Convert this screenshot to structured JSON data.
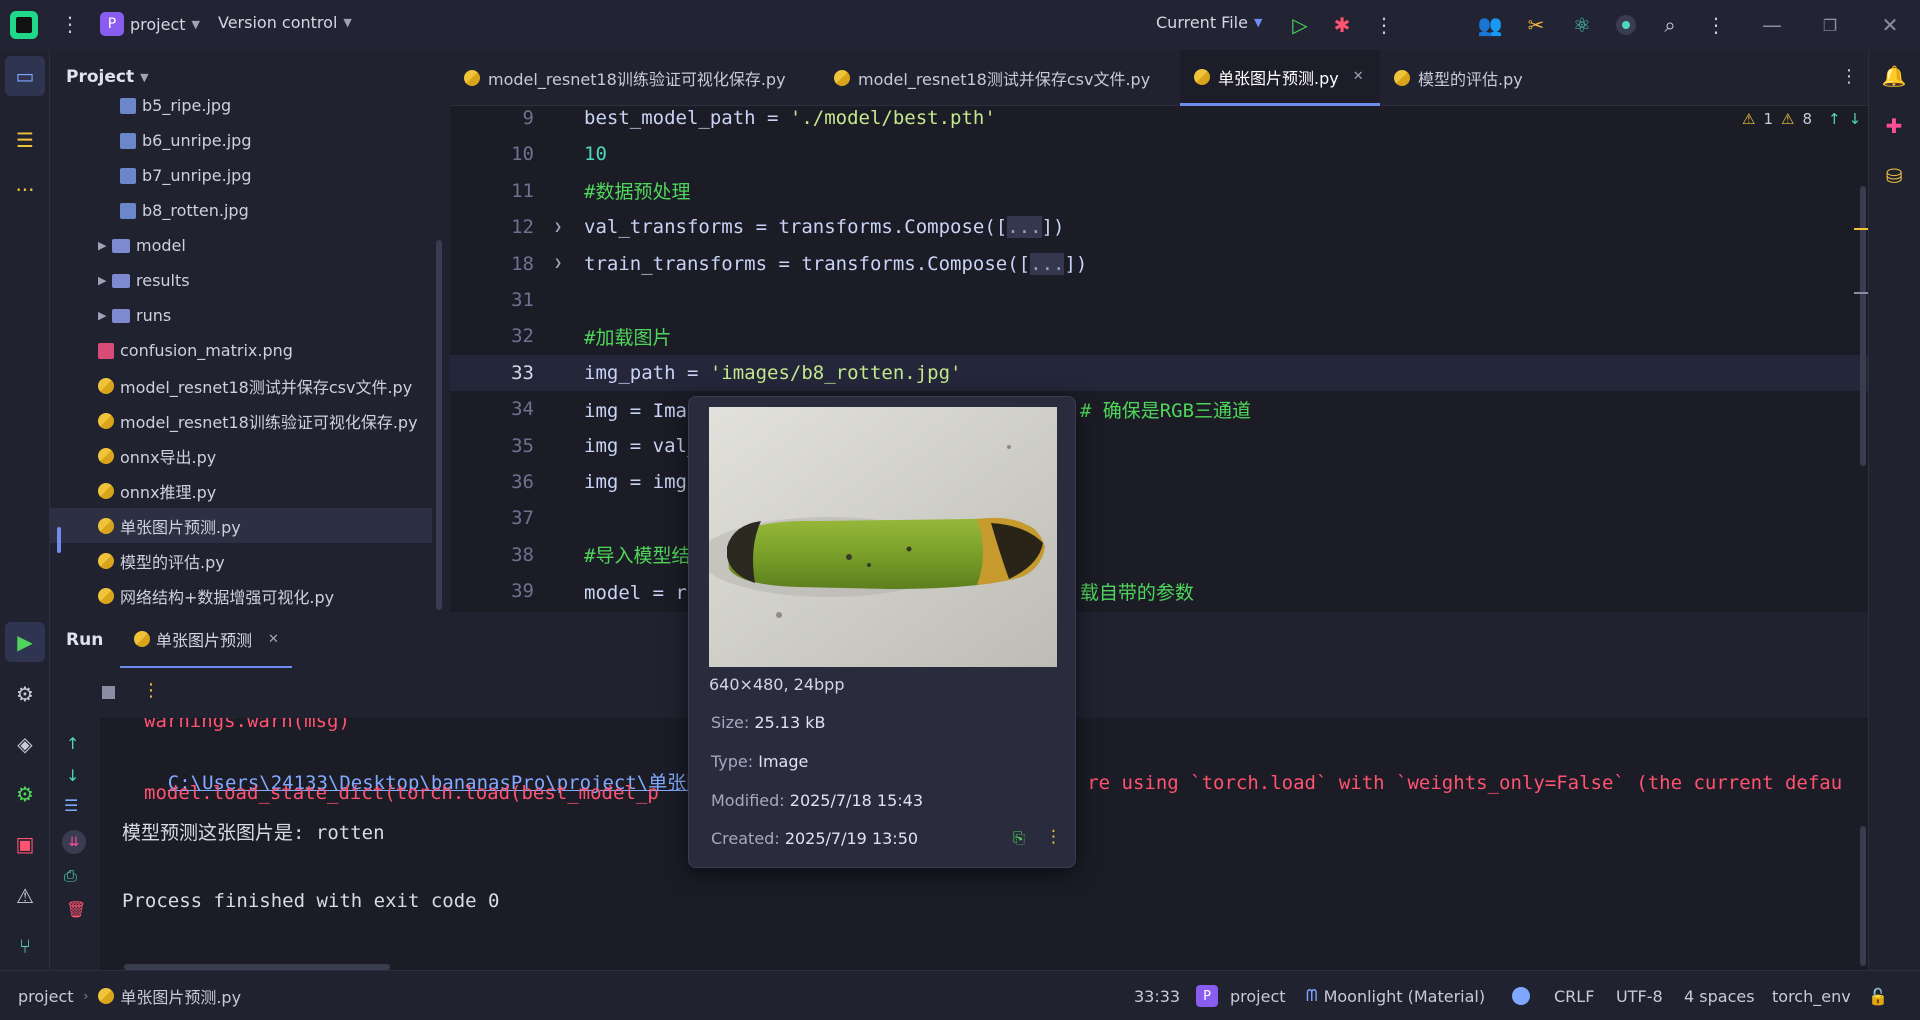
{
  "topbar": {
    "project_initial": "P",
    "project_name": "project",
    "version_control": "Version control",
    "run_config": "Current File",
    "colors": {
      "bg": "#222333",
      "project_badge": "#8a5cf0"
    }
  },
  "project_panel": {
    "title": "Project",
    "items": [
      {
        "label": "b5_ripe.jpg",
        "kind": "image"
      },
      {
        "label": "b6_unripe.jpg",
        "kind": "image"
      },
      {
        "label": "b7_unripe.jpg",
        "kind": "image"
      },
      {
        "label": "b8_rotten.jpg",
        "kind": "image"
      },
      {
        "label": "model",
        "kind": "folder"
      },
      {
        "label": "results",
        "kind": "folder"
      },
      {
        "label": "runs",
        "kind": "folder"
      },
      {
        "label": "confusion_matrix.png",
        "kind": "png"
      },
      {
        "label": "model_resnet18测试并保存csv文件.py",
        "kind": "python"
      },
      {
        "label": "model_resnet18训练验证可视化保存.py",
        "kind": "python"
      },
      {
        "label": "onnx导出.py",
        "kind": "python"
      },
      {
        "label": "onnx推理.py",
        "kind": "python"
      },
      {
        "label": "单张图片预测.py",
        "kind": "python",
        "selected": true
      },
      {
        "label": "模型的评估.py",
        "kind": "python"
      },
      {
        "label": "网络结构+数据增强可视化.py",
        "kind": "python"
      }
    ]
  },
  "tabs": [
    {
      "label": "model_resnet18训练验证可视化保存.py"
    },
    {
      "label": "model_resnet18测试并保存csv文件.py"
    },
    {
      "label": "单张图片预测.py",
      "active": true
    },
    {
      "label": "模型的评估.py"
    }
  ],
  "inspections": {
    "warn1": "1",
    "warn2": "8"
  },
  "editor": {
    "lines": [
      {
        "num": "9",
        "a": "best_model_path = ",
        "b": "'./model/best.pth'",
        "c": ""
      },
      {
        "num": "10",
        "a": "",
        "b": "10",
        "c": ""
      },
      {
        "num": "11",
        "a": "",
        "b": "#数据预处理",
        "c": ""
      },
      {
        "num": "12",
        "a": "val_transforms = transforms.Compose([",
        "b": "...",
        "c": "])"
      },
      {
        "num": "18",
        "a": "train_transforms = transforms.Compose([",
        "b": "...",
        "c": "])"
      },
      {
        "num": "31",
        "a": "",
        "b": "",
        "c": ""
      },
      {
        "num": "32",
        "a": "",
        "b": "#加载图片",
        "c": ""
      },
      {
        "num": "33",
        "a": "img_path = ",
        "b": "'images/b8_rotten.jpg'",
        "c": ""
      },
      {
        "num": "34",
        "a": "img = Image",
        "b": "# 确保是RGB三通道",
        "c": ""
      },
      {
        "num": "35",
        "a": "img = val_t",
        "b": "",
        "c": ""
      },
      {
        "num": "36",
        "a": "img = img.u",
        "b": "",
        "c": ""
      },
      {
        "num": "37",
        "a": "",
        "b": "",
        "c": ""
      },
      {
        "num": "38",
        "a": "",
        "b": "#导入模型结构",
        "c": ""
      },
      {
        "num": "39",
        "a": "model = res",
        "b": "载自带的参数",
        "c": ""
      }
    ]
  },
  "run": {
    "title": "Run",
    "tab_label": "单张图片预测",
    "console": {
      "l1": "warnings.warn(msg)",
      "l2_link": "C:\\Users\\24133\\Desktop\\bananasPro\\project\\单张图",
      "l2_rest": "re using `torch.load` with `weights_only=False` (the current defau",
      "l3": "model.load_state_dict(torch.load(best_model_p",
      "l4": "模型预测这张图片是: rotten",
      "l5": "Process finished with exit code 0"
    }
  },
  "tooltip": {
    "dims": "640×480, 24bpp",
    "size_label": "Size:",
    "size": "25.13 kB",
    "type_label": "Type:",
    "type": "Image",
    "modified_label": "Modified:",
    "modified": "2025/7/18 15:43",
    "created_label": "Created:",
    "created": "2025/7/19 13:50"
  },
  "status": {
    "crumb_project": "project",
    "crumb_file": "单张图片预测.py",
    "position": "33:33",
    "project_initial": "P",
    "project": "project",
    "theme": "Moonlight (Material)",
    "line_sep": "CRLF",
    "encoding": "UTF-8",
    "indent": "4 spaces",
    "interpreter": "torch_env"
  }
}
